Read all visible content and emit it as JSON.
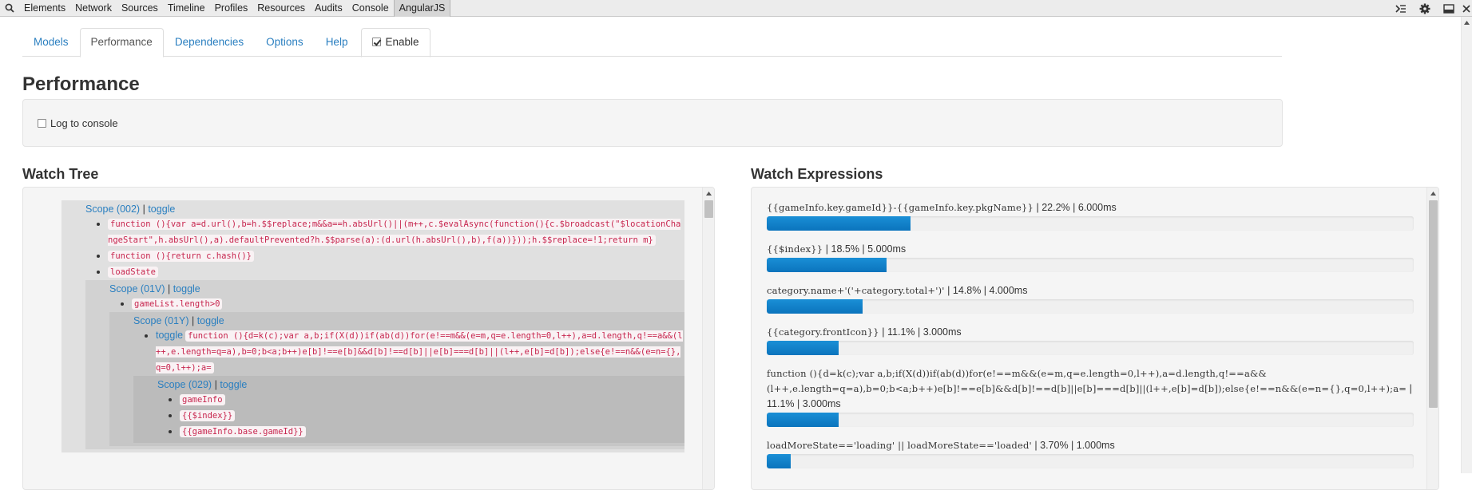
{
  "devtools": {
    "tabs": [
      "Elements",
      "Network",
      "Sources",
      "Timeline",
      "Profiles",
      "Resources",
      "Audits",
      "Console",
      "AngularJS"
    ],
    "active_tab": "AngularJS"
  },
  "nav": {
    "tabs": [
      {
        "label": "Models"
      },
      {
        "label": "Performance"
      },
      {
        "label": "Dependencies"
      },
      {
        "label": "Options"
      },
      {
        "label": "Help"
      }
    ],
    "enable_label": "Enable",
    "enable_checked": true
  },
  "page": {
    "title": "Performance",
    "log_to_console_label": "Log to console"
  },
  "watch_tree": {
    "title": "Watch Tree",
    "scope1": {
      "name": "Scope (002)",
      "toggle": "toggle",
      "watchers": [
        "function (){var a=d.url(),b=h.$$replace;m&&a==h.absUrl()||(m++,c.$evalAsync(function(){c.$broadcast(\"$locationChangeStart\",h.absUrl(),a).defaultPrevented?h.$$parse(a):(d.url(h.absUrl(),b),f(a))}));h.$$replace=!1;return m}",
        "function (){return c.hash()}",
        "loadState"
      ]
    },
    "scope2": {
      "name": "Scope (01V)",
      "toggle": "toggle",
      "watchers": [
        "gameList.length>0"
      ]
    },
    "scope3": {
      "name": "Scope (01Y)",
      "toggle": "toggle",
      "watcher_toggle": "toggle",
      "watchers": [
        "function (){d=k(c);var a,b;if(X(d))if(ab(d))for(e!==m&&(e=m,q=e.length=0,l++),a=d.length,q!==a&&(l++,e.length=q=a),b=0;b<a;b++)e[b]!==e[b]&&d[b]!==d[b]||e[b]===d[b]||(l++,e[b]=d[b]);else{e!==n&&(e=n={},q=0,l++);a="
      ]
    },
    "scope4": {
      "name": "Scope (029)",
      "toggle": "toggle",
      "watchers": [
        "gameInfo",
        "{{$index}}",
        "{{gameInfo.base.gameId}}"
      ]
    },
    "scope_separator": "|"
  },
  "watch_expressions": {
    "title": "Watch Expressions",
    "items": [
      {
        "expr": "{{gameInfo.key.gameId}}-{{gameInfo.key.pkgName}}",
        "stats": " | 22.2% | 6.000ms",
        "percent": 22.2
      },
      {
        "expr": "{{$index}}",
        "stats": " | 18.5% | 5.000ms",
        "percent": 18.5
      },
      {
        "expr": "category.name+'('+category.total+')'",
        "stats": " | 14.8% | 4.000ms",
        "percent": 14.8
      },
      {
        "expr": "{{category.frontIcon}}",
        "stats": " | 11.1% | 3.000ms",
        "percent": 11.1
      },
      {
        "expr": "function (){d=k(c);var a,b;if(X(d))if(ab(d))for(e!==m&&(e=m,q=e.length=0,l++),a=d.length,q!==a&&(l++,e.length=q=a),b=0;b<a;b++)e[b]!==e[b]&&d[b]!==d[b]||e[b]===d[b]||(l++,e[b]=d[b]);else{e!==n&&(e=n={},q=0,l++);a=",
        "stats": " | 11.1% | 3.000ms",
        "percent": 11.1
      },
      {
        "expr": "loadMoreState=='loading' || loadMoreState=='loaded'",
        "stats": " | 3.70% | 1.000ms",
        "percent": 3.7
      }
    ]
  },
  "colors": {
    "link": "#2a7fc0",
    "code": "#c7254e",
    "bar": "#0b74bd"
  }
}
